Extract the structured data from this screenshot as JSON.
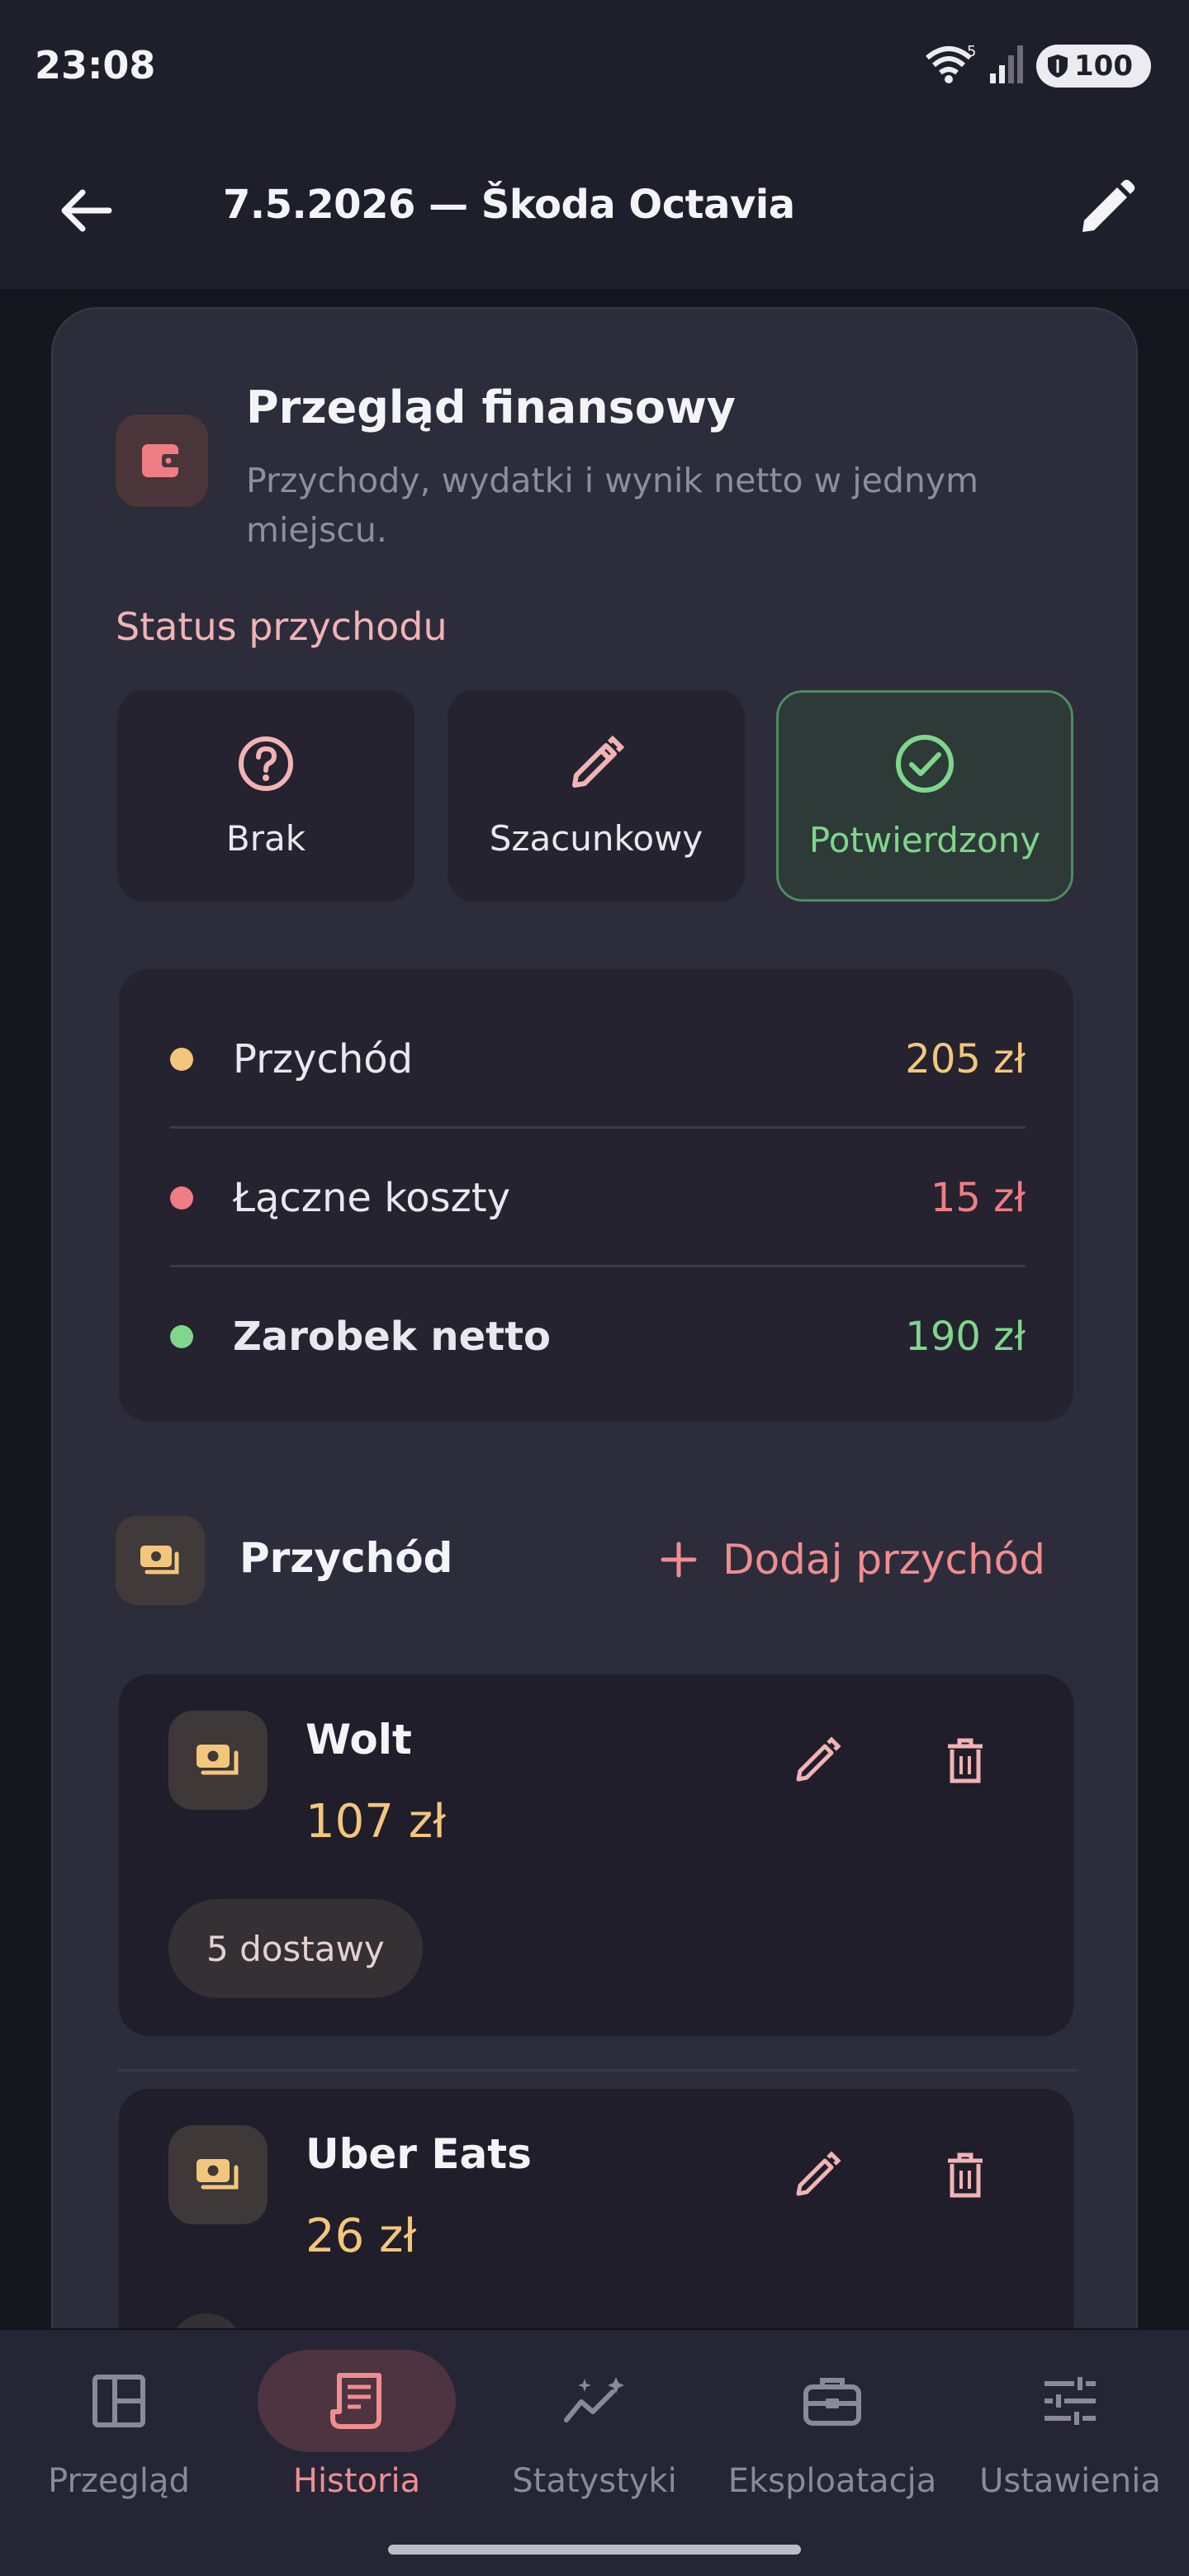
{
  "status_bar": {
    "time": "23:08",
    "wifi_badge": "5",
    "battery": "100"
  },
  "top_bar": {
    "title": "7.5.2026 — Škoda Octavia"
  },
  "overview": {
    "title": "Przegląd finansowy",
    "subtitle": "Przychody, wydatki i wynik netto w jednym miejscu."
  },
  "income_status": {
    "label": "Status przychodu",
    "options": [
      {
        "label": "Brak",
        "icon": "question-circle-icon"
      },
      {
        "label": "Szacunkowy",
        "icon": "pencil-icon"
      },
      {
        "label": "Potwierdzony",
        "icon": "check-circle-icon",
        "selected": true
      }
    ]
  },
  "summary": {
    "rows": [
      {
        "name": "Przychód",
        "value": "205 zł",
        "color": "#f4c67c"
      },
      {
        "name": "Łączne koszty",
        "value": "15 zł",
        "color": "#f07c84"
      },
      {
        "name": "Zarobek netto",
        "value": "190 zł",
        "color": "#7fd68c"
      }
    ]
  },
  "income": {
    "title": "Przychód",
    "add_label": "Dodaj przychód",
    "entries": [
      {
        "name": "Wolt",
        "amount": "107 zł",
        "chip": "5 dostawy"
      },
      {
        "name": "Uber Eats",
        "amount": "26 zł",
        "chip": ""
      }
    ]
  },
  "bottom_nav": {
    "items": [
      {
        "label": "Przegląd",
        "icon": "dashboard-icon"
      },
      {
        "label": "Historia",
        "icon": "receipt-icon",
        "active": true
      },
      {
        "label": "Statystyki",
        "icon": "chart-sparkle-icon"
      },
      {
        "label": "Eksploatacja",
        "icon": "toolbox-icon"
      },
      {
        "label": "Ustawienia",
        "icon": "sliders-icon"
      }
    ]
  },
  "colors": {
    "accent": "#f08d8f",
    "income": "#f4c67c",
    "cost": "#f07c84",
    "net": "#7fd68c"
  }
}
